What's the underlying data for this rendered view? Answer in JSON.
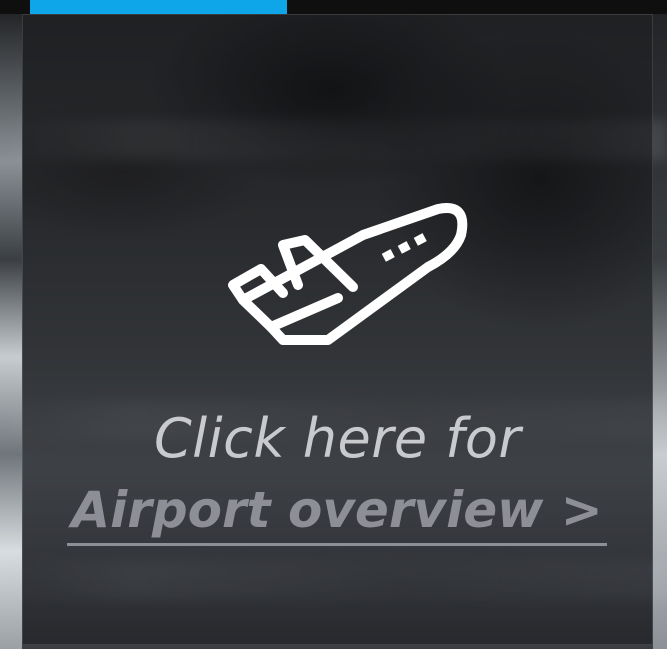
{
  "tile": {
    "caption_line1": "Click here for",
    "link_label": "Airport overview >"
  },
  "icons": {
    "main": "airplane-takeoff-icon"
  },
  "colors": {
    "accent": "#0ea5e9",
    "caption_text": "#c9cacd",
    "link_text": "#8e8f96",
    "icon_stroke": "#ffffff"
  }
}
